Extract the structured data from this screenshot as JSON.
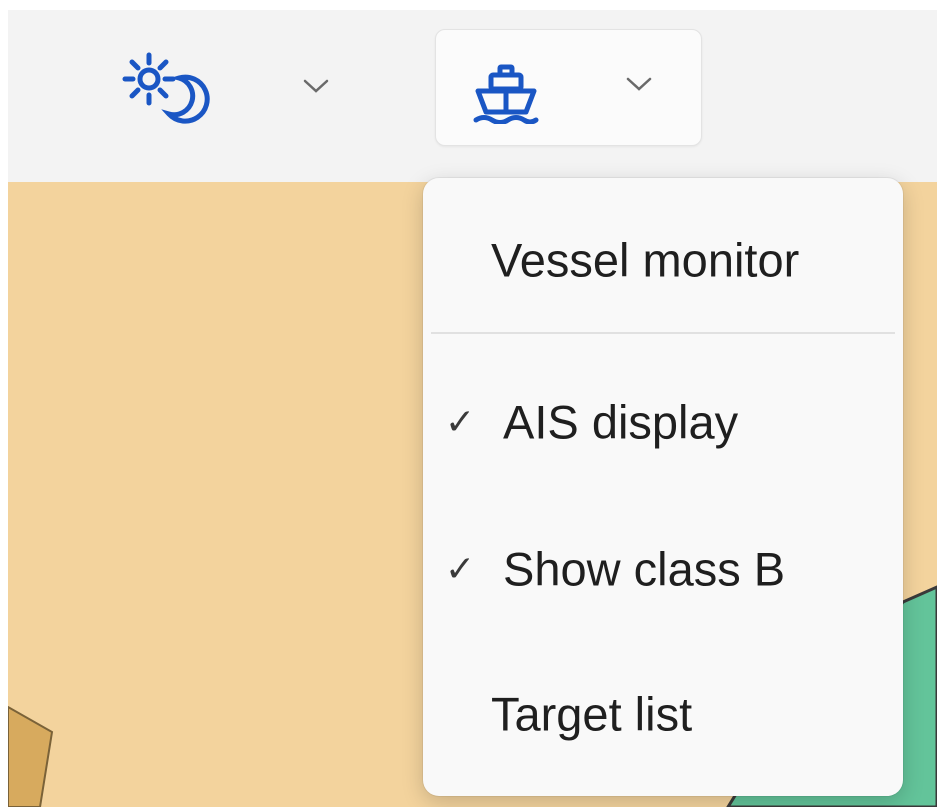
{
  "toolbar": {
    "theme_button": {
      "icon": "sun-moon-icon",
      "chevron": "chevron-down-icon"
    },
    "vessel_button": {
      "icon": "ship-icon",
      "chevron": "chevron-down-icon"
    }
  },
  "menu": {
    "header": "Vessel monitor",
    "items": [
      {
        "label": "AIS display",
        "checked": true,
        "check_glyph": "✓"
      },
      {
        "label": "Show class B",
        "checked": true,
        "check_glyph": "✓"
      },
      {
        "label": "Target list",
        "checked": false,
        "check_glyph": ""
      }
    ]
  },
  "colors": {
    "accent": "#1a56c4",
    "map_land": "#f3d39d",
    "map_feature": "#d7aa5e",
    "map_water": "#63c49a",
    "menu_bg": "#f9f9f9",
    "toolbar_bg": "#f3f3f3"
  }
}
